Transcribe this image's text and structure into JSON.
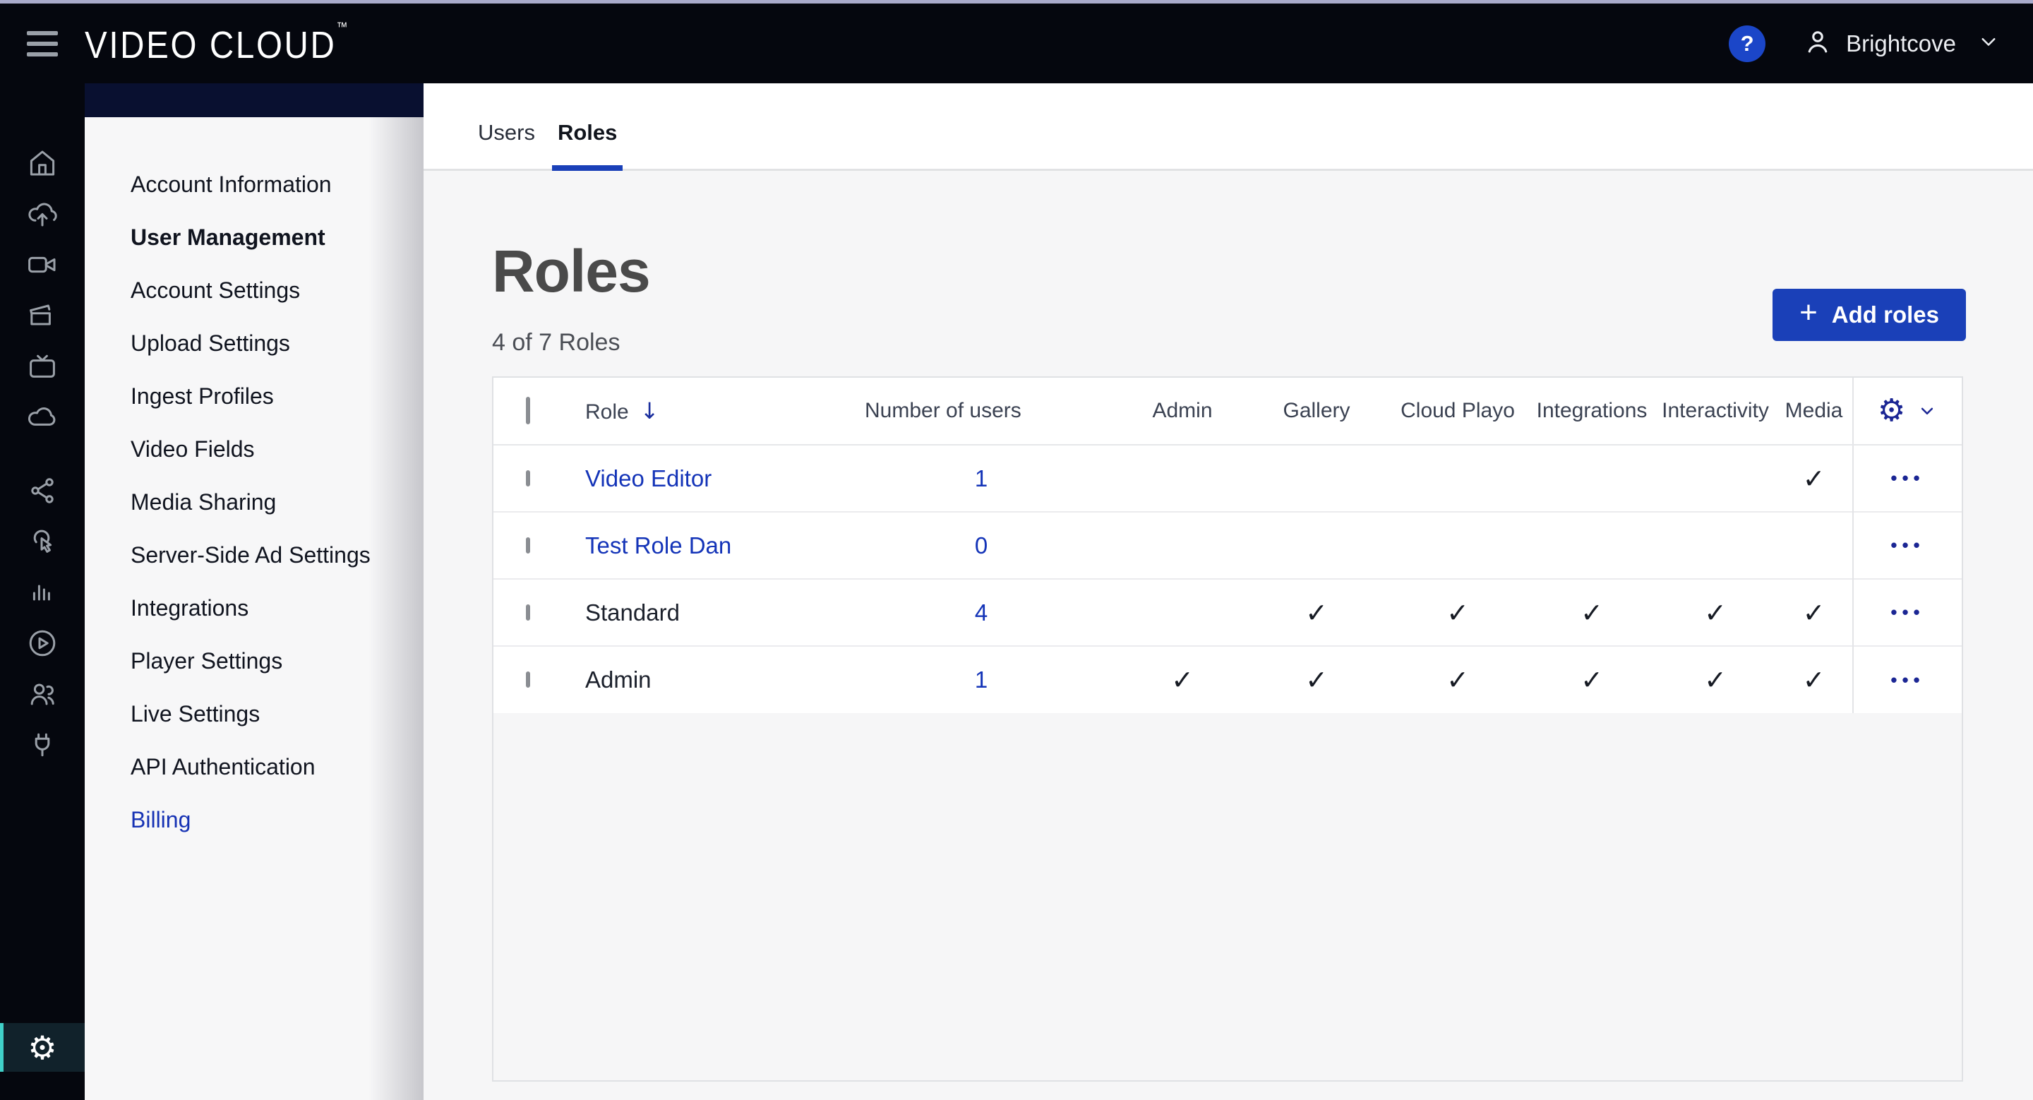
{
  "topbar": {
    "logo": "VIDEO CLOUD",
    "logo_tm": "™",
    "help_label": "?",
    "account_name": "Brightcove"
  },
  "icons": {
    "gear": "⚙",
    "sort_down": "↓",
    "plus": "+",
    "ellipsis": "•••"
  },
  "sidebar": {
    "items": [
      {
        "icon": "home"
      },
      {
        "icon": "cloud-upload"
      },
      {
        "icon": "video-camera"
      },
      {
        "icon": "clapperboard"
      },
      {
        "icon": "tv"
      },
      {
        "icon": "cloud"
      },
      {
        "icon": "share"
      },
      {
        "icon": "interactivity"
      },
      {
        "icon": "analytics"
      },
      {
        "icon": "play-circle"
      },
      {
        "icon": "users"
      },
      {
        "icon": "plug"
      }
    ],
    "bottom_icon": "settings-gear"
  },
  "subnav": {
    "items": [
      {
        "label": "Account Information"
      },
      {
        "label": "User Management",
        "active": true
      },
      {
        "label": "Account Settings"
      },
      {
        "label": "Upload Settings"
      },
      {
        "label": "Ingest Profiles"
      },
      {
        "label": "Video Fields"
      },
      {
        "label": "Media Sharing"
      },
      {
        "label": "Server-Side Ad Settings"
      },
      {
        "label": "Integrations"
      },
      {
        "label": "Player Settings"
      },
      {
        "label": "Live Settings"
      },
      {
        "label": "API Authentication"
      },
      {
        "label": "Billing",
        "link": true
      }
    ]
  },
  "main": {
    "tabs": [
      {
        "label": "Users",
        "active": false
      },
      {
        "label": "Roles",
        "active": true
      }
    ],
    "heading": "Roles",
    "count_text": "4 of 7 Roles",
    "add_button": {
      "label": "Add roles"
    },
    "table": {
      "columns": {
        "role": "Role",
        "users": "Number of users",
        "admin": "Admin",
        "gallery": "Gallery",
        "cloud_playo": "Cloud Playo",
        "integrations": "Integrations",
        "interactivity": "Interactivity",
        "media": "Media"
      },
      "rows": [
        {
          "name": "Video Editor",
          "is_link": true,
          "users": "1",
          "checks": {
            "admin": "",
            "gallery": "",
            "cloud_playo": "",
            "integrations": "",
            "interactivity": "",
            "media": "✓"
          }
        },
        {
          "name": "Test Role Dan",
          "is_link": true,
          "users": "0",
          "checks": {
            "admin": "",
            "gallery": "",
            "cloud_playo": "",
            "integrations": "",
            "interactivity": "",
            "media": ""
          }
        },
        {
          "name": "Standard",
          "is_link": false,
          "users": "4",
          "checks": {
            "admin": "",
            "gallery": "✓",
            "cloud_playo": "✓",
            "integrations": "✓",
            "interactivity": "✓",
            "media": "✓"
          }
        },
        {
          "name": "Admin",
          "is_link": false,
          "users": "1",
          "checks": {
            "admin": "✓",
            "gallery": "✓",
            "cloud_playo": "✓",
            "integrations": "✓",
            "interactivity": "✓",
            "media": "✓"
          }
        }
      ]
    }
  },
  "colors": {
    "accent_blue": "#1a40b8",
    "link_blue": "#1434b8",
    "navy_icon": "#1b2694",
    "help_bg": "#1b46c8",
    "teal_accent": "#40d0c8",
    "topbar_bg": "#05070e"
  }
}
